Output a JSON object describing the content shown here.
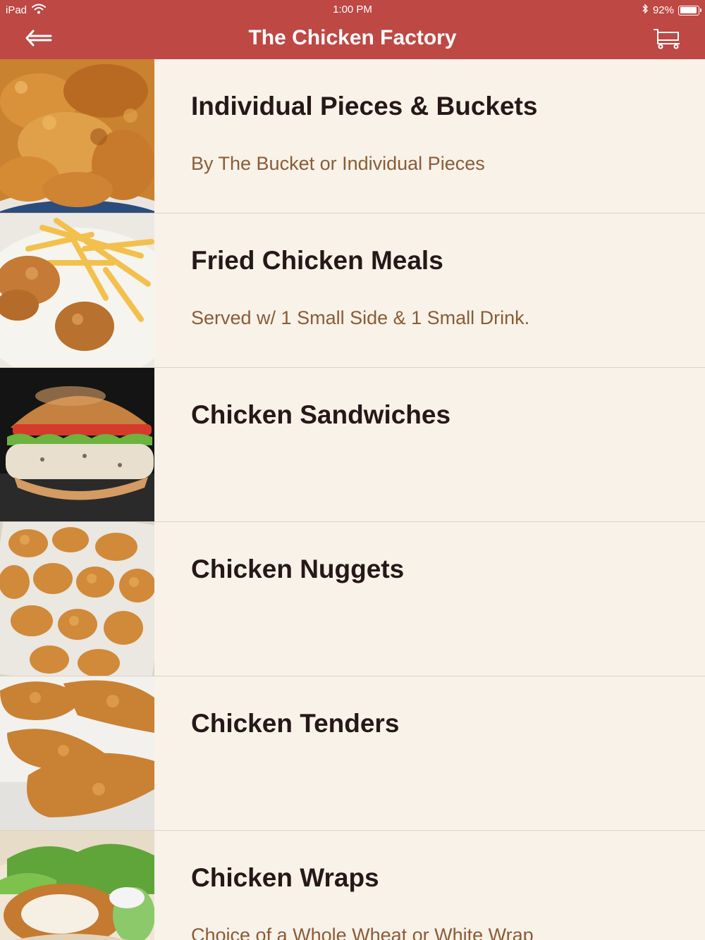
{
  "status_bar": {
    "device": "iPad",
    "time": "1:00 PM",
    "battery": "92%",
    "battery_level": 0.92
  },
  "nav": {
    "title": "The Chicken Factory",
    "back_icon": "back-arrow-icon",
    "cart_icon": "cart-icon"
  },
  "colors": {
    "header": "#bd4844",
    "background": "#f9f2e8",
    "title_text": "#261818",
    "subtitle_text": "#8a5c38"
  },
  "categories": [
    {
      "title": "Individual Pieces & Buckets",
      "subtitle": "By The Bucket or Individual Pieces",
      "image": "fried-chicken-pieces-image"
    },
    {
      "title": "Fried Chicken Meals",
      "subtitle": "Served w/ 1 Small Side & 1 Small Drink.",
      "image": "chicken-and-fries-image"
    },
    {
      "title": "Chicken Sandwiches",
      "subtitle": "",
      "image": "chicken-sandwich-image"
    },
    {
      "title": "Chicken Nuggets",
      "subtitle": "",
      "image": "chicken-nuggets-image"
    },
    {
      "title": "Chicken Tenders",
      "subtitle": "",
      "image": "chicken-tenders-image"
    },
    {
      "title": "Chicken Wraps",
      "subtitle": "Choice of a Whole Wheat or White Wrap",
      "image": "chicken-wrap-image"
    }
  ]
}
